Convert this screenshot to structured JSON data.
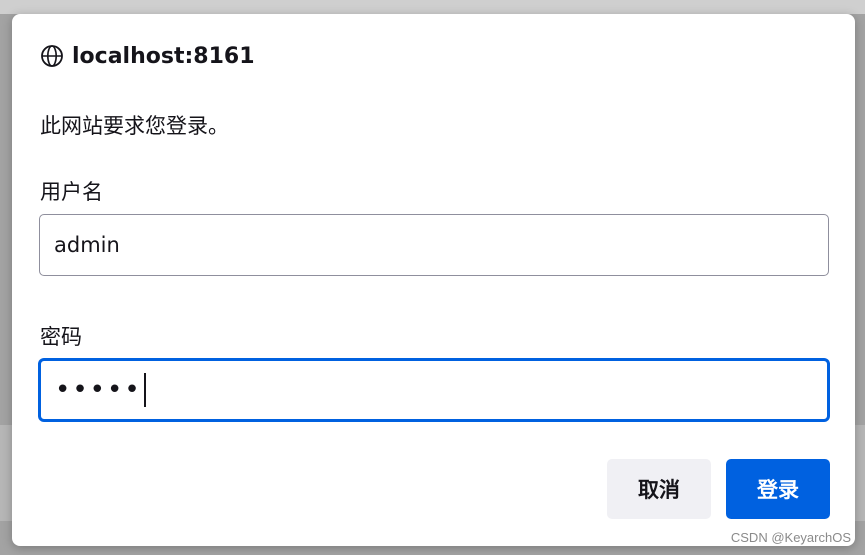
{
  "dialog": {
    "origin": "localhost:8161",
    "prompt": "此网站要求您登录。",
    "icon": "globe-icon"
  },
  "username": {
    "label": "用户名",
    "value": "admin"
  },
  "password": {
    "label": "密码",
    "masked_value": "•••••"
  },
  "buttons": {
    "cancel": "取消",
    "login": "登录"
  },
  "colors": {
    "accent": "#0061e0",
    "cancel_bg": "#f0f0f4",
    "text": "#15141a"
  },
  "watermark": "CSDN @KeyarchOS"
}
